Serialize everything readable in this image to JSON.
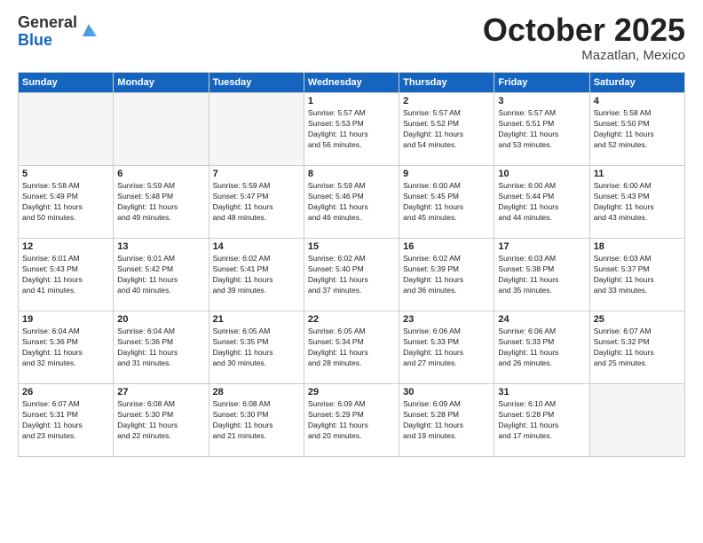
{
  "header": {
    "logo_general": "General",
    "logo_blue": "Blue",
    "month": "October 2025",
    "location": "Mazatlan, Mexico"
  },
  "days_of_week": [
    "Sunday",
    "Monday",
    "Tuesday",
    "Wednesday",
    "Thursday",
    "Friday",
    "Saturday"
  ],
  "weeks": [
    [
      {
        "day": "",
        "text": ""
      },
      {
        "day": "",
        "text": ""
      },
      {
        "day": "",
        "text": ""
      },
      {
        "day": "1",
        "text": "Sunrise: 5:57 AM\nSunset: 5:53 PM\nDaylight: 11 hours\nand 56 minutes."
      },
      {
        "day": "2",
        "text": "Sunrise: 5:57 AM\nSunset: 5:52 PM\nDaylight: 11 hours\nand 54 minutes."
      },
      {
        "day": "3",
        "text": "Sunrise: 5:57 AM\nSunset: 5:51 PM\nDaylight: 11 hours\nand 53 minutes."
      },
      {
        "day": "4",
        "text": "Sunrise: 5:58 AM\nSunset: 5:50 PM\nDaylight: 11 hours\nand 52 minutes."
      }
    ],
    [
      {
        "day": "5",
        "text": "Sunrise: 5:58 AM\nSunset: 5:49 PM\nDaylight: 11 hours\nand 50 minutes."
      },
      {
        "day": "6",
        "text": "Sunrise: 5:59 AM\nSunset: 5:48 PM\nDaylight: 11 hours\nand 49 minutes."
      },
      {
        "day": "7",
        "text": "Sunrise: 5:59 AM\nSunset: 5:47 PM\nDaylight: 11 hours\nand 48 minutes."
      },
      {
        "day": "8",
        "text": "Sunrise: 5:59 AM\nSunset: 5:46 PM\nDaylight: 11 hours\nand 46 minutes."
      },
      {
        "day": "9",
        "text": "Sunrise: 6:00 AM\nSunset: 5:45 PM\nDaylight: 11 hours\nand 45 minutes."
      },
      {
        "day": "10",
        "text": "Sunrise: 6:00 AM\nSunset: 5:44 PM\nDaylight: 11 hours\nand 44 minutes."
      },
      {
        "day": "11",
        "text": "Sunrise: 6:00 AM\nSunset: 5:43 PM\nDaylight: 11 hours\nand 43 minutes."
      }
    ],
    [
      {
        "day": "12",
        "text": "Sunrise: 6:01 AM\nSunset: 5:43 PM\nDaylight: 11 hours\nand 41 minutes."
      },
      {
        "day": "13",
        "text": "Sunrise: 6:01 AM\nSunset: 5:42 PM\nDaylight: 11 hours\nand 40 minutes."
      },
      {
        "day": "14",
        "text": "Sunrise: 6:02 AM\nSunset: 5:41 PM\nDaylight: 11 hours\nand 39 minutes."
      },
      {
        "day": "15",
        "text": "Sunrise: 6:02 AM\nSunset: 5:40 PM\nDaylight: 11 hours\nand 37 minutes."
      },
      {
        "day": "16",
        "text": "Sunrise: 6:02 AM\nSunset: 5:39 PM\nDaylight: 11 hours\nand 36 minutes."
      },
      {
        "day": "17",
        "text": "Sunrise: 6:03 AM\nSunset: 5:38 PM\nDaylight: 11 hours\nand 35 minutes."
      },
      {
        "day": "18",
        "text": "Sunrise: 6:03 AM\nSunset: 5:37 PM\nDaylight: 11 hours\nand 33 minutes."
      }
    ],
    [
      {
        "day": "19",
        "text": "Sunrise: 6:04 AM\nSunset: 5:36 PM\nDaylight: 11 hours\nand 32 minutes."
      },
      {
        "day": "20",
        "text": "Sunrise: 6:04 AM\nSunset: 5:36 PM\nDaylight: 11 hours\nand 31 minutes."
      },
      {
        "day": "21",
        "text": "Sunrise: 6:05 AM\nSunset: 5:35 PM\nDaylight: 11 hours\nand 30 minutes."
      },
      {
        "day": "22",
        "text": "Sunrise: 6:05 AM\nSunset: 5:34 PM\nDaylight: 11 hours\nand 28 minutes."
      },
      {
        "day": "23",
        "text": "Sunrise: 6:06 AM\nSunset: 5:33 PM\nDaylight: 11 hours\nand 27 minutes."
      },
      {
        "day": "24",
        "text": "Sunrise: 6:06 AM\nSunset: 5:33 PM\nDaylight: 11 hours\nand 26 minutes."
      },
      {
        "day": "25",
        "text": "Sunrise: 6:07 AM\nSunset: 5:32 PM\nDaylight: 11 hours\nand 25 minutes."
      }
    ],
    [
      {
        "day": "26",
        "text": "Sunrise: 6:07 AM\nSunset: 5:31 PM\nDaylight: 11 hours\nand 23 minutes."
      },
      {
        "day": "27",
        "text": "Sunrise: 6:08 AM\nSunset: 5:30 PM\nDaylight: 11 hours\nand 22 minutes."
      },
      {
        "day": "28",
        "text": "Sunrise: 6:08 AM\nSunset: 5:30 PM\nDaylight: 11 hours\nand 21 minutes."
      },
      {
        "day": "29",
        "text": "Sunrise: 6:09 AM\nSunset: 5:29 PM\nDaylight: 11 hours\nand 20 minutes."
      },
      {
        "day": "30",
        "text": "Sunrise: 6:09 AM\nSunset: 5:28 PM\nDaylight: 11 hours\nand 19 minutes."
      },
      {
        "day": "31",
        "text": "Sunrise: 6:10 AM\nSunset: 5:28 PM\nDaylight: 11 hours\nand 17 minutes."
      },
      {
        "day": "",
        "text": ""
      }
    ]
  ]
}
